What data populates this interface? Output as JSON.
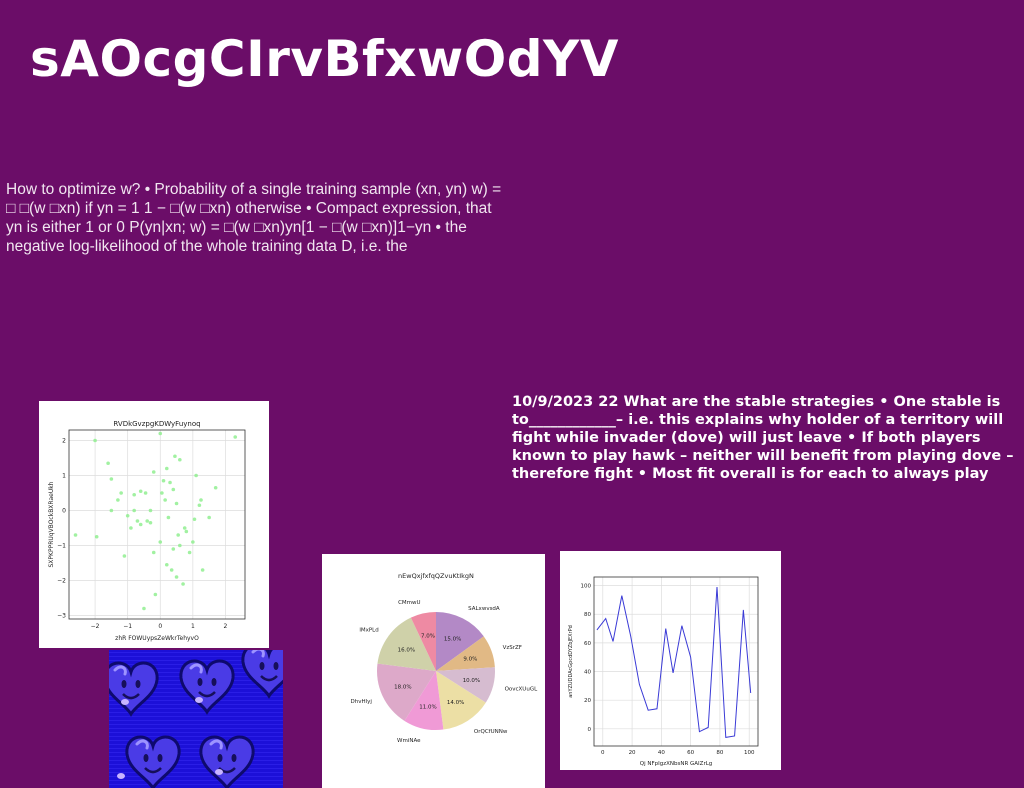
{
  "page": {
    "title": "sAOcgCIrvBfxwOdYV",
    "paragraph": "How to optimize w? • Probability of a single training sample (xn, yn) w) = □ □(w □xn) if yn = 1 1 − □(w □xn) otherwise • Compact expression, that yn is either 1 or 0 P(yn|xn; w) = □(w □xn)yn[1 − □(w □xn)]1−yn • the negative log-likelihood of the whole training data D, i.e. the",
    "bold_paragraph": "10/9/2023 22 What are the stable strategies • One stable is to____________– i.e. this explains why holder of a territory will fight while invader (dove) will just leave • If both players known to play hawk – neither will benefit from playing dove – therefore fight • Most fit overall is for each to always play"
  },
  "chart_data": [
    {
      "type": "scatter",
      "title": "RVDkGvzpgKDWyFuynoq",
      "xlabel": "zhR FOWUypsZeWkrTehyvO",
      "ylabel": "SXPKPPRUqVBOckBXRaeUkh",
      "xlim": [
        -2.8,
        2.6
      ],
      "ylim": [
        -3.1,
        2.3
      ],
      "xticks": [
        "−2",
        "−1",
        "0",
        "1",
        "2"
      ],
      "yticks": [
        "−3",
        "−2",
        "−1",
        "0",
        "1",
        "2"
      ],
      "grid": true,
      "color": "#90ee90",
      "x": [
        -2.6,
        -2.0,
        -1.95,
        -1.6,
        -1.5,
        -1.5,
        -1.3,
        -1.2,
        -1.1,
        -0.9,
        -0.8,
        -0.7,
        -0.6,
        -0.5,
        -0.45,
        -0.4,
        -0.3,
        -0.2,
        -0.2,
        -0.15,
        0.0,
        0.0,
        0.05,
        0.1,
        0.15,
        0.2,
        0.25,
        0.3,
        0.35,
        0.4,
        0.45,
        0.5,
        0.5,
        0.55,
        0.6,
        0.7,
        0.75,
        0.8,
        0.9,
        1.0,
        1.05,
        1.1,
        1.2,
        1.25,
        1.3,
        1.5,
        1.7,
        2.3,
        -0.8,
        -0.6,
        0.2,
        -0.3,
        0.6,
        -1.0,
        0.4
      ],
      "y": [
        -0.7,
        2.0,
        -0.75,
        1.35,
        0.9,
        0.0,
        0.3,
        0.5,
        -1.3,
        -0.5,
        0.45,
        -0.3,
        -0.4,
        -2.8,
        0.5,
        -0.3,
        0.0,
        1.1,
        -1.2,
        -2.4,
        -0.9,
        2.2,
        0.5,
        0.85,
        0.3,
        1.2,
        -0.2,
        0.8,
        -1.7,
        -1.1,
        1.55,
        -1.9,
        0.2,
        -0.7,
        1.45,
        -2.1,
        -0.5,
        -0.6,
        -1.2,
        -0.9,
        -0.25,
        1.0,
        0.15,
        0.3,
        -1.7,
        -0.2,
        0.65,
        2.1,
        0.0,
        0.55,
        -1.55,
        -0.35,
        -1.0,
        -0.15,
        0.6
      ]
    },
    {
      "type": "pie",
      "title": "nEwQxjfxfqQZvuKtIkgN",
      "labels": [
        "SALxwvsdA",
        "VzSrZF",
        "OovcXUuGL",
        "OrQCfUNNw",
        "WmiNAe",
        "DhvHlyj",
        "lMxPLd",
        "CMmwU"
      ],
      "values": [
        15.0,
        9.0,
        10.0,
        14.0,
        11.0,
        18.0,
        16.0,
        7.0
      ],
      "value_labels": [
        "15.0%",
        "9.0%",
        "10.0%",
        "14.0%",
        "11.0%",
        "18.0%",
        "16.0%",
        "7.0%"
      ],
      "colors": [
        "#b389c6",
        "#e1b985",
        "#d6bcd0",
        "#ecdfa5",
        "#f09ad6",
        "#dda9c9",
        "#cfd1a9",
        "#ee8aa3"
      ]
    },
    {
      "type": "line",
      "title": "",
      "xlabel": "Qj NFpIgzXNbsNR GAIZrLg",
      "ylabel": "anYZUDDAcGpcdDYZbJEXrPd",
      "xlim": [
        -6,
        106
      ],
      "ylim": [
        -12,
        106
      ],
      "xticks": [
        "0",
        "20",
        "40",
        "60",
        "80",
        "100"
      ],
      "yticks": [
        "0",
        "20",
        "40",
        "60",
        "80",
        "100"
      ],
      "grid": true,
      "color": "#3a3ad6",
      "x": [
        -4,
        2,
        7,
        13,
        19,
        25,
        31,
        37,
        43,
        48,
        54,
        60,
        66,
        72,
        78,
        84,
        90,
        96,
        101
      ],
      "y": [
        69,
        77,
        61,
        93,
        65,
        31,
        13,
        14,
        70,
        39,
        72,
        50,
        -2,
        1,
        99,
        -6,
        -5,
        83,
        25,
        29
      ]
    }
  ]
}
